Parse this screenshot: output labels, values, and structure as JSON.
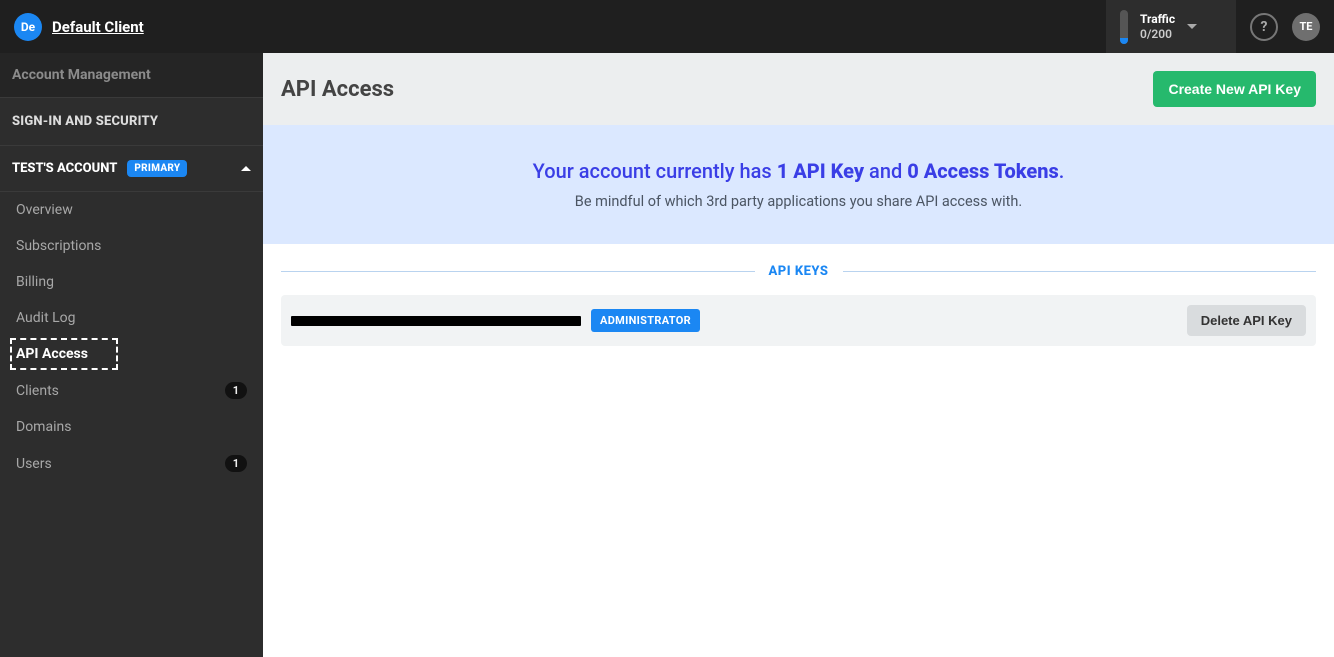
{
  "topbar": {
    "client_avatar_text": "De",
    "client_name": "Default Client",
    "traffic_label": "Traffic",
    "traffic_value": "0/200",
    "help_icon_text": "?",
    "user_avatar_text": "TE"
  },
  "sidebar": {
    "account_management": "Account Management",
    "signin_security": "SIGN-IN AND SECURITY",
    "account_name": "TEST'S ACCOUNT",
    "primary_badge": "PRIMARY",
    "items": {
      "overview": "Overview",
      "subscriptions": "Subscriptions",
      "billing": "Billing",
      "audit_log": "Audit Log",
      "api_access": "API Access",
      "clients": "Clients",
      "domains": "Domains",
      "users": "Users"
    },
    "counts": {
      "clients": "1",
      "users": "1"
    }
  },
  "page": {
    "title": "API Access",
    "create_button": "Create New API Key",
    "banner": {
      "prefix": "Your account currently has ",
      "api_key_count": "1 API Key",
      "mid": " and ",
      "access_tokens": "0 Access Tokens",
      "suffix": ".",
      "subtext": "Be mindful of which 3rd party applications you share API access with."
    },
    "api_keys_label": "API KEYS",
    "key_row": {
      "admin_badge": "ADMINISTRATOR",
      "delete_button": "Delete API Key"
    }
  }
}
